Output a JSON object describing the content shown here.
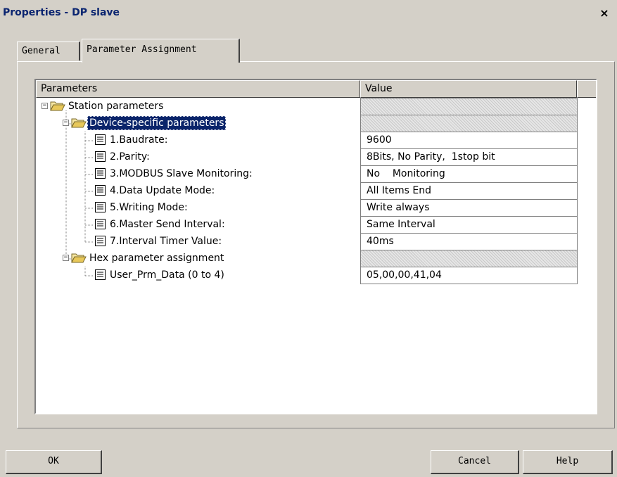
{
  "window": {
    "title": "Properties - DP slave",
    "close_glyph": "×"
  },
  "tabs": [
    {
      "label": "General",
      "active": false
    },
    {
      "label": "Parameter Assignment",
      "active": true
    }
  ],
  "table": {
    "columns": [
      "Parameters",
      "Value"
    ],
    "rows": [
      {
        "label": "Station parameters",
        "value": "",
        "icon": "folder-icon",
        "level": 0
      },
      {
        "label": "Device-specific parameters",
        "value": "",
        "icon": "folder-icon",
        "level": 1,
        "selected": true
      },
      {
        "label": "1.Baudrate:",
        "value": "9600",
        "icon": "document-icon",
        "level": 2
      },
      {
        "label": "2.Parity:",
        "value": "8Bits, No Parity,  1stop bit",
        "icon": "document-icon",
        "level": 2
      },
      {
        "label": "3.MODBUS Slave Monitoring:",
        "value": "No    Monitoring",
        "icon": "document-icon",
        "level": 2
      },
      {
        "label": "4.Data Update Mode:",
        "value": "All Items End",
        "icon": "document-icon",
        "level": 2
      },
      {
        "label": "5.Writing Mode:",
        "value": "Write always",
        "icon": "document-icon",
        "level": 2
      },
      {
        "label": "6.Master Send Interval:",
        "value": "Same Interval",
        "icon": "document-icon",
        "level": 2
      },
      {
        "label": "7.Interval Timer Value:",
        "value": "40ms",
        "icon": "document-icon",
        "level": 2
      },
      {
        "label": "Hex parameter assignment",
        "value": "",
        "icon": "folder-icon",
        "level": 1
      },
      {
        "label": "User_Prm_Data (0 to 4)",
        "value": "05,00,00,41,04",
        "icon": "document-icon",
        "level": 2
      }
    ]
  },
  "buttons": {
    "ok": "OK",
    "cancel": "Cancel",
    "help": "Help"
  },
  "colors": {
    "selection": "#0a246a",
    "dialog_bg": "#d4d0c8",
    "title_text": "#0a2470"
  }
}
